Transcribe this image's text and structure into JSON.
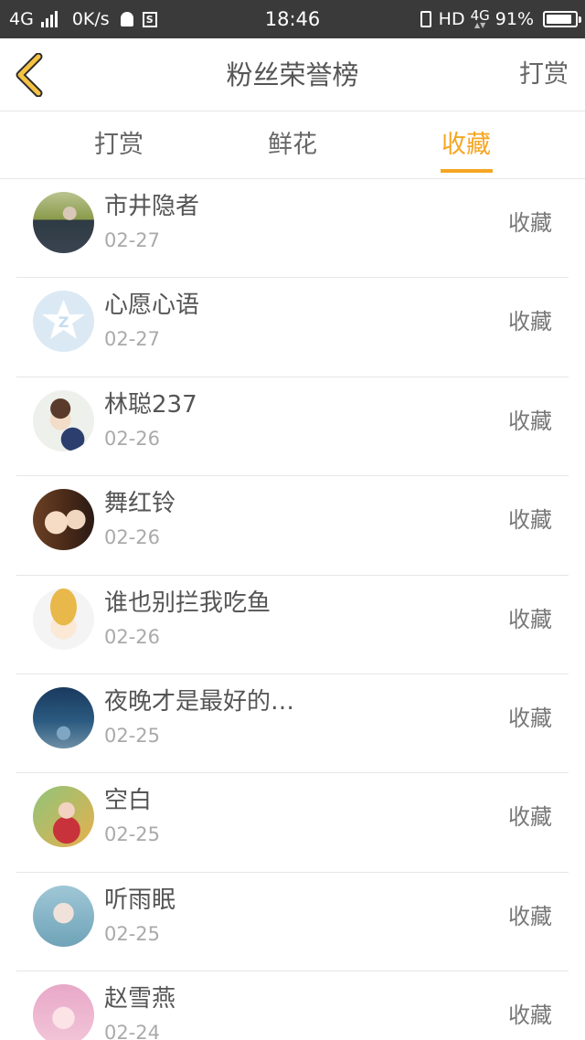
{
  "status_bar": {
    "network": "4G",
    "speed": "0K/s",
    "sim_icon_label": "S",
    "time": "18:46",
    "hd": "HD",
    "net_right": "4G",
    "battery_text": "91%",
    "battery_level": 0.91
  },
  "header": {
    "title": "粉丝荣誉榜",
    "action": "打赏"
  },
  "tabs": [
    {
      "label": "打赏"
    },
    {
      "label": "鲜花"
    },
    {
      "label": "收藏"
    }
  ],
  "active_tab": 2,
  "colors": {
    "accent": "#f5a623",
    "status_bar_bg": "#3a3a3a"
  },
  "list": [
    {
      "name": "市井隐者",
      "date": "02-27",
      "action": "收藏",
      "avatar_icon": "man-photo-avatar"
    },
    {
      "name": "心愿心语",
      "date": "02-27",
      "action": "收藏",
      "avatar_icon": "default-star-avatar"
    },
    {
      "name": "林聪237",
      "date": "02-26",
      "action": "收藏",
      "avatar_icon": "cartoon-boy-avatar"
    },
    {
      "name": "舞红铃",
      "date": "02-26",
      "action": "收藏",
      "avatar_icon": "anime-girls-avatar"
    },
    {
      "name": "谁也别拦我吃鱼",
      "date": "02-26",
      "action": "收藏",
      "avatar_icon": "straw-hat-avatar"
    },
    {
      "name": "夜晚才是最好的…",
      "date": "02-25",
      "action": "收藏",
      "avatar_icon": "night-sky-avatar"
    },
    {
      "name": "空白",
      "date": "02-25",
      "action": "收藏",
      "avatar_icon": "anime-red-avatar"
    },
    {
      "name": "听雨眠",
      "date": "02-25",
      "action": "收藏",
      "avatar_icon": "blurry-photo-avatar"
    },
    {
      "name": "赵雪燕",
      "date": "02-24",
      "action": "收藏",
      "avatar_icon": "pink-anime-avatar"
    }
  ]
}
